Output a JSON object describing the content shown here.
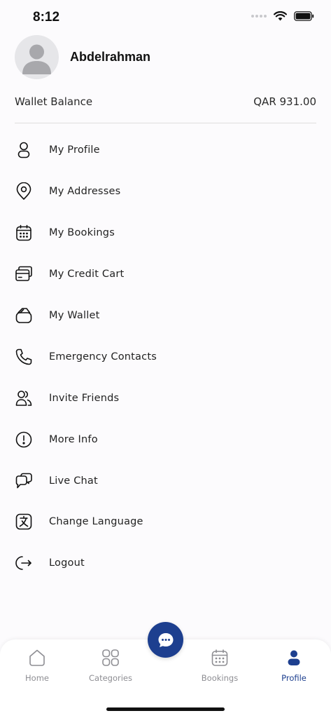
{
  "status_bar": {
    "time": "8:12"
  },
  "profile": {
    "name": "Abdelrahman"
  },
  "wallet": {
    "label": "Wallet Balance",
    "amount": "QAR 931.00"
  },
  "menu": {
    "items": [
      {
        "label": "My Profile",
        "icon": "person-icon"
      },
      {
        "label": "My Addresses",
        "icon": "location-pin-icon"
      },
      {
        "label": "My Bookings",
        "icon": "calendar-icon"
      },
      {
        "label": "My Credit Cart",
        "icon": "credit-card-icon"
      },
      {
        "label": "My Wallet",
        "icon": "wallet-icon"
      },
      {
        "label": "Emergency Contacts",
        "icon": "phone-icon"
      },
      {
        "label": "Invite Friends",
        "icon": "users-icon"
      },
      {
        "label": "More Info",
        "icon": "info-circle-icon"
      },
      {
        "label": "Live Chat",
        "icon": "chat-bubbles-icon"
      },
      {
        "label": "Change Language",
        "icon": "language-icon"
      },
      {
        "label": "Logout",
        "icon": "logout-icon"
      }
    ]
  },
  "tabs": {
    "home": "Home",
    "categories": "Categories",
    "bookings": "Bookings",
    "profile": "Profile",
    "active": "profile"
  },
  "colors": {
    "accent": "#1d3f8f",
    "inactive": "#8e8e93",
    "background": "#fcfbfd"
  }
}
